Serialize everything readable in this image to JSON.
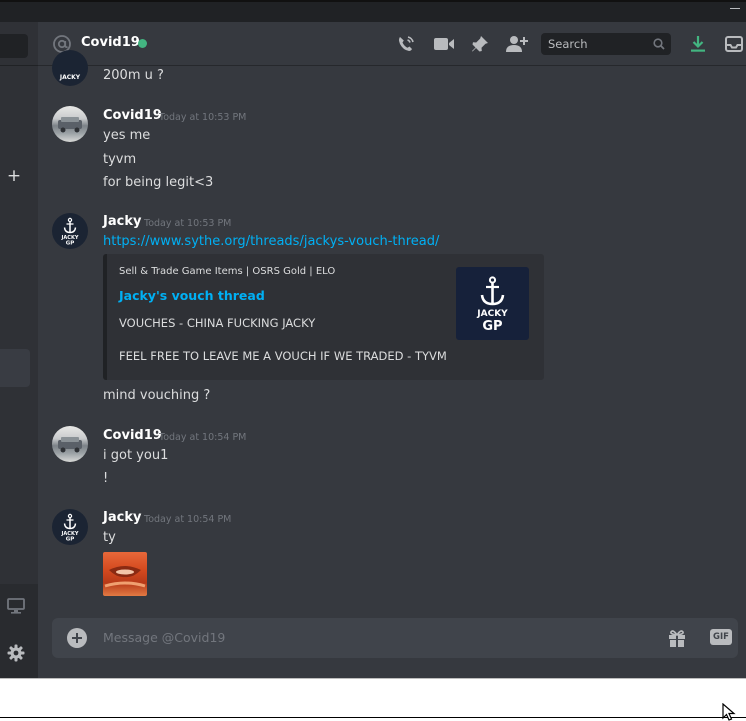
{
  "header": {
    "title": "Covid19",
    "search_placeholder": "Search",
    "icons": [
      "at-icon",
      "call-icon",
      "video-icon",
      "pin-icon",
      "add-friend-icon",
      "search-icon",
      "download-icon",
      "inbox-icon"
    ],
    "status_color": "#43b581"
  },
  "sidebar": {
    "plus": "+",
    "icons": [
      "monitor-icon",
      "gear-icon"
    ]
  },
  "messages": [
    {
      "author": "",
      "lines": [
        "200m u ?"
      ]
    },
    {
      "author": "Covid19",
      "timestamp": "Today at 10:53 PM",
      "lines": [
        "yes me",
        "tyvm",
        "for being legit<3"
      ]
    },
    {
      "author": "Jacky",
      "timestamp": "Today at 10:53 PM",
      "link": "https://www.sythe.org/threads/jackys-vouch-thread/",
      "embed": {
        "provider": "Sell & Trade Game Items | OSRS Gold | ELO",
        "title": "Jacky's vouch thread",
        "desc1": "VOUCHES - CHINA FUCKING JACKY",
        "desc2": "FEEL FREE TO LEAVE ME A VOUCH IF WE TRADED - TYVM",
        "thumb_line1": "JACKY",
        "thumb_line2": "GP"
      },
      "after": "mind vouching ?"
    },
    {
      "author": "Covid19",
      "timestamp": "Today at 10:54 PM",
      "lines": [
        "i got you1",
        "!"
      ]
    },
    {
      "author": "Jacky",
      "timestamp": "Today at 10:54 PM",
      "lines": [
        "ty"
      ]
    }
  ],
  "avatar_labels": {
    "jacky_line1": "JACKY",
    "jacky_line2": "GP"
  },
  "composer": {
    "placeholder": "Message @Covid19",
    "gif_label": "GIF"
  },
  "colors": {
    "link": "#00b0f4",
    "background": "#36393f",
    "sidebar": "#2f3136"
  }
}
